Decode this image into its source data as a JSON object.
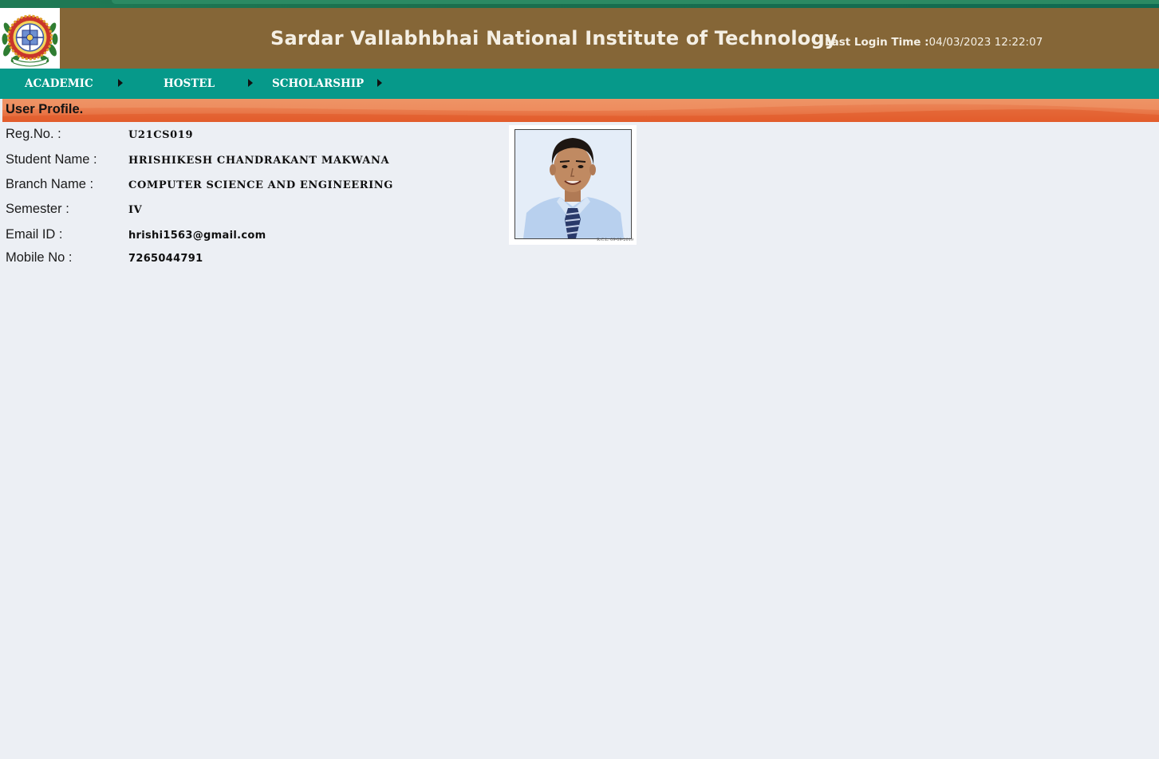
{
  "header": {
    "site_title": "Sardar Vallabhbhai National Institute of Technology",
    "last_login_label": "Last Login Time :",
    "last_login_value": "04/03/2023 12:22:07"
  },
  "nav": {
    "items": [
      {
        "label": "ACADEMIC"
      },
      {
        "label": "HOSTEL"
      },
      {
        "label": "SCHOLARSHIP"
      }
    ]
  },
  "section": {
    "title": "User Profile."
  },
  "profile": {
    "reg_no_label": "Reg.No. :",
    "reg_no": "U21CS019",
    "student_name_label": "Student Name :",
    "student_name": "HRISHIKESH CHANDRAKANT MAKWANA",
    "branch_label": "Branch Name :",
    "branch": "COMPUTER SCIENCE AND ENGINEERING",
    "semester_label": "Semester :",
    "semester": "IV",
    "email_label": "Email ID :",
    "email": "hrishi1563@gmail.com",
    "mobile_label": "Mobile No :",
    "mobile": "7265044791"
  },
  "photo": {
    "stamp": "R.C.L. 09-09-2019"
  },
  "colors": {
    "header_bg": "#856637",
    "nav_bg": "#06998a",
    "section_bar": "#e9794a",
    "page_bg": "#eceff4"
  }
}
